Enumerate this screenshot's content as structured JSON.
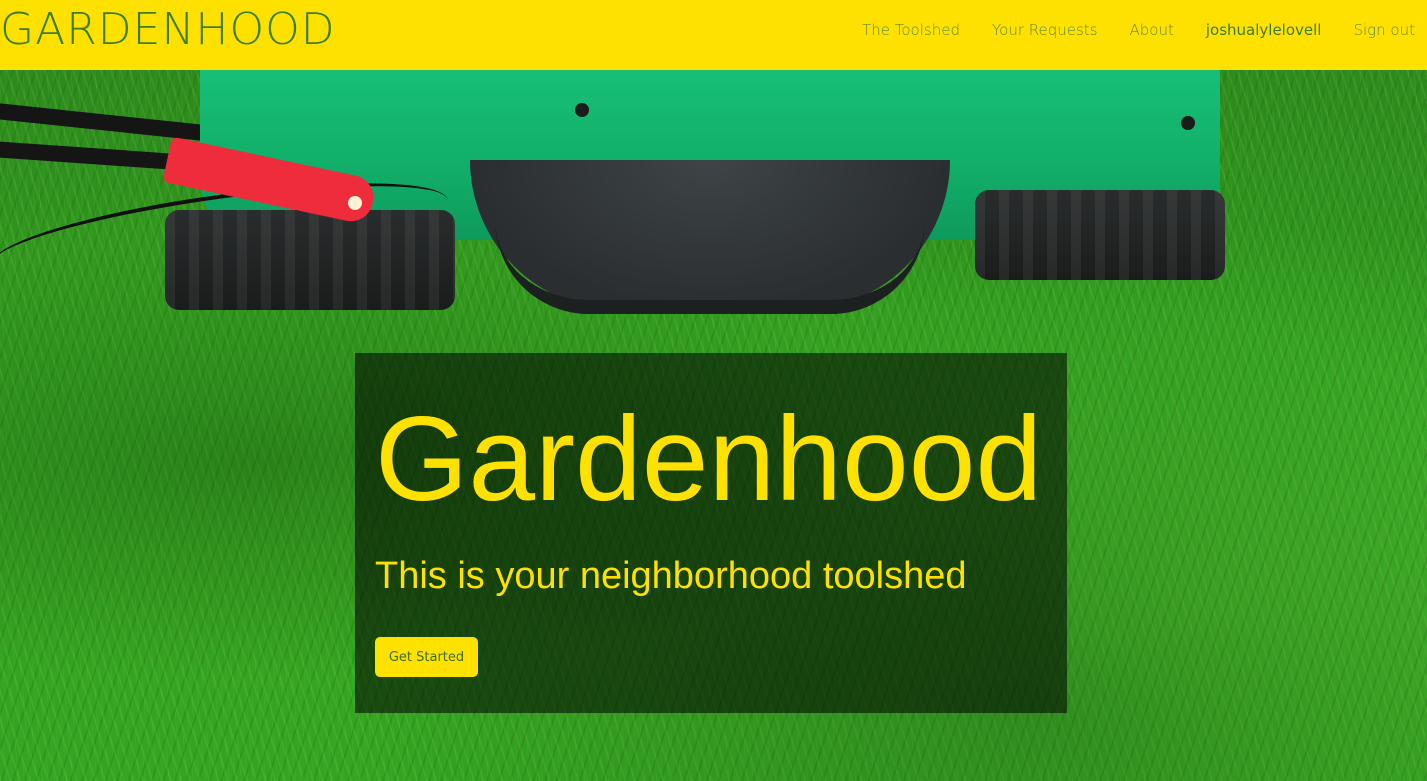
{
  "navbar": {
    "brand": "GARDENHOOD",
    "links": [
      {
        "label": "The Toolshed"
      },
      {
        "label": "Your Requests"
      },
      {
        "label": "About"
      },
      {
        "label": "joshualylelovell"
      },
      {
        "label": "Sign out"
      }
    ]
  },
  "hero": {
    "title": "Gardenhood",
    "subtitle": "This is your neighborhood toolshed",
    "cta_label": "Get Started"
  },
  "colors": {
    "navbar_background": "#ffe100",
    "brand_text": "#3c7d1e",
    "accent_yellow": "#ffe100",
    "mower_green": "#19c47a"
  }
}
